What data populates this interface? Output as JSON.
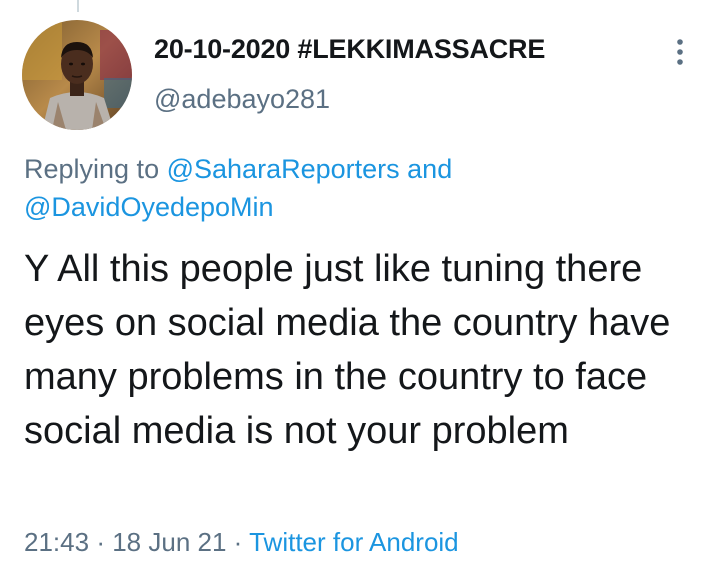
{
  "tweet": {
    "author": {
      "display_name": "20-10-2020 #LEKKIMASSACRE",
      "handle": "@adebayo281",
      "avatar_icon": "profile-photo"
    },
    "reply_context": {
      "prefix": "Replying to",
      "mention_1": "@SaharaReporters",
      "conjunction": "and",
      "mention_2": "@DavidOyedepoMin"
    },
    "text": "Y All this people just like tuning there eyes on social media the country have many problems in the country to face social media is not your problem",
    "meta": {
      "time": "21:43",
      "separator": "·",
      "date": "18 Jun 21",
      "source": "Twitter for Android"
    },
    "more_icon": "vertical-ellipsis-icon"
  },
  "colors": {
    "text_primary": "#14171a",
    "text_secondary": "#5b7083",
    "link": "#1b95e0",
    "background": "#ffffff"
  }
}
